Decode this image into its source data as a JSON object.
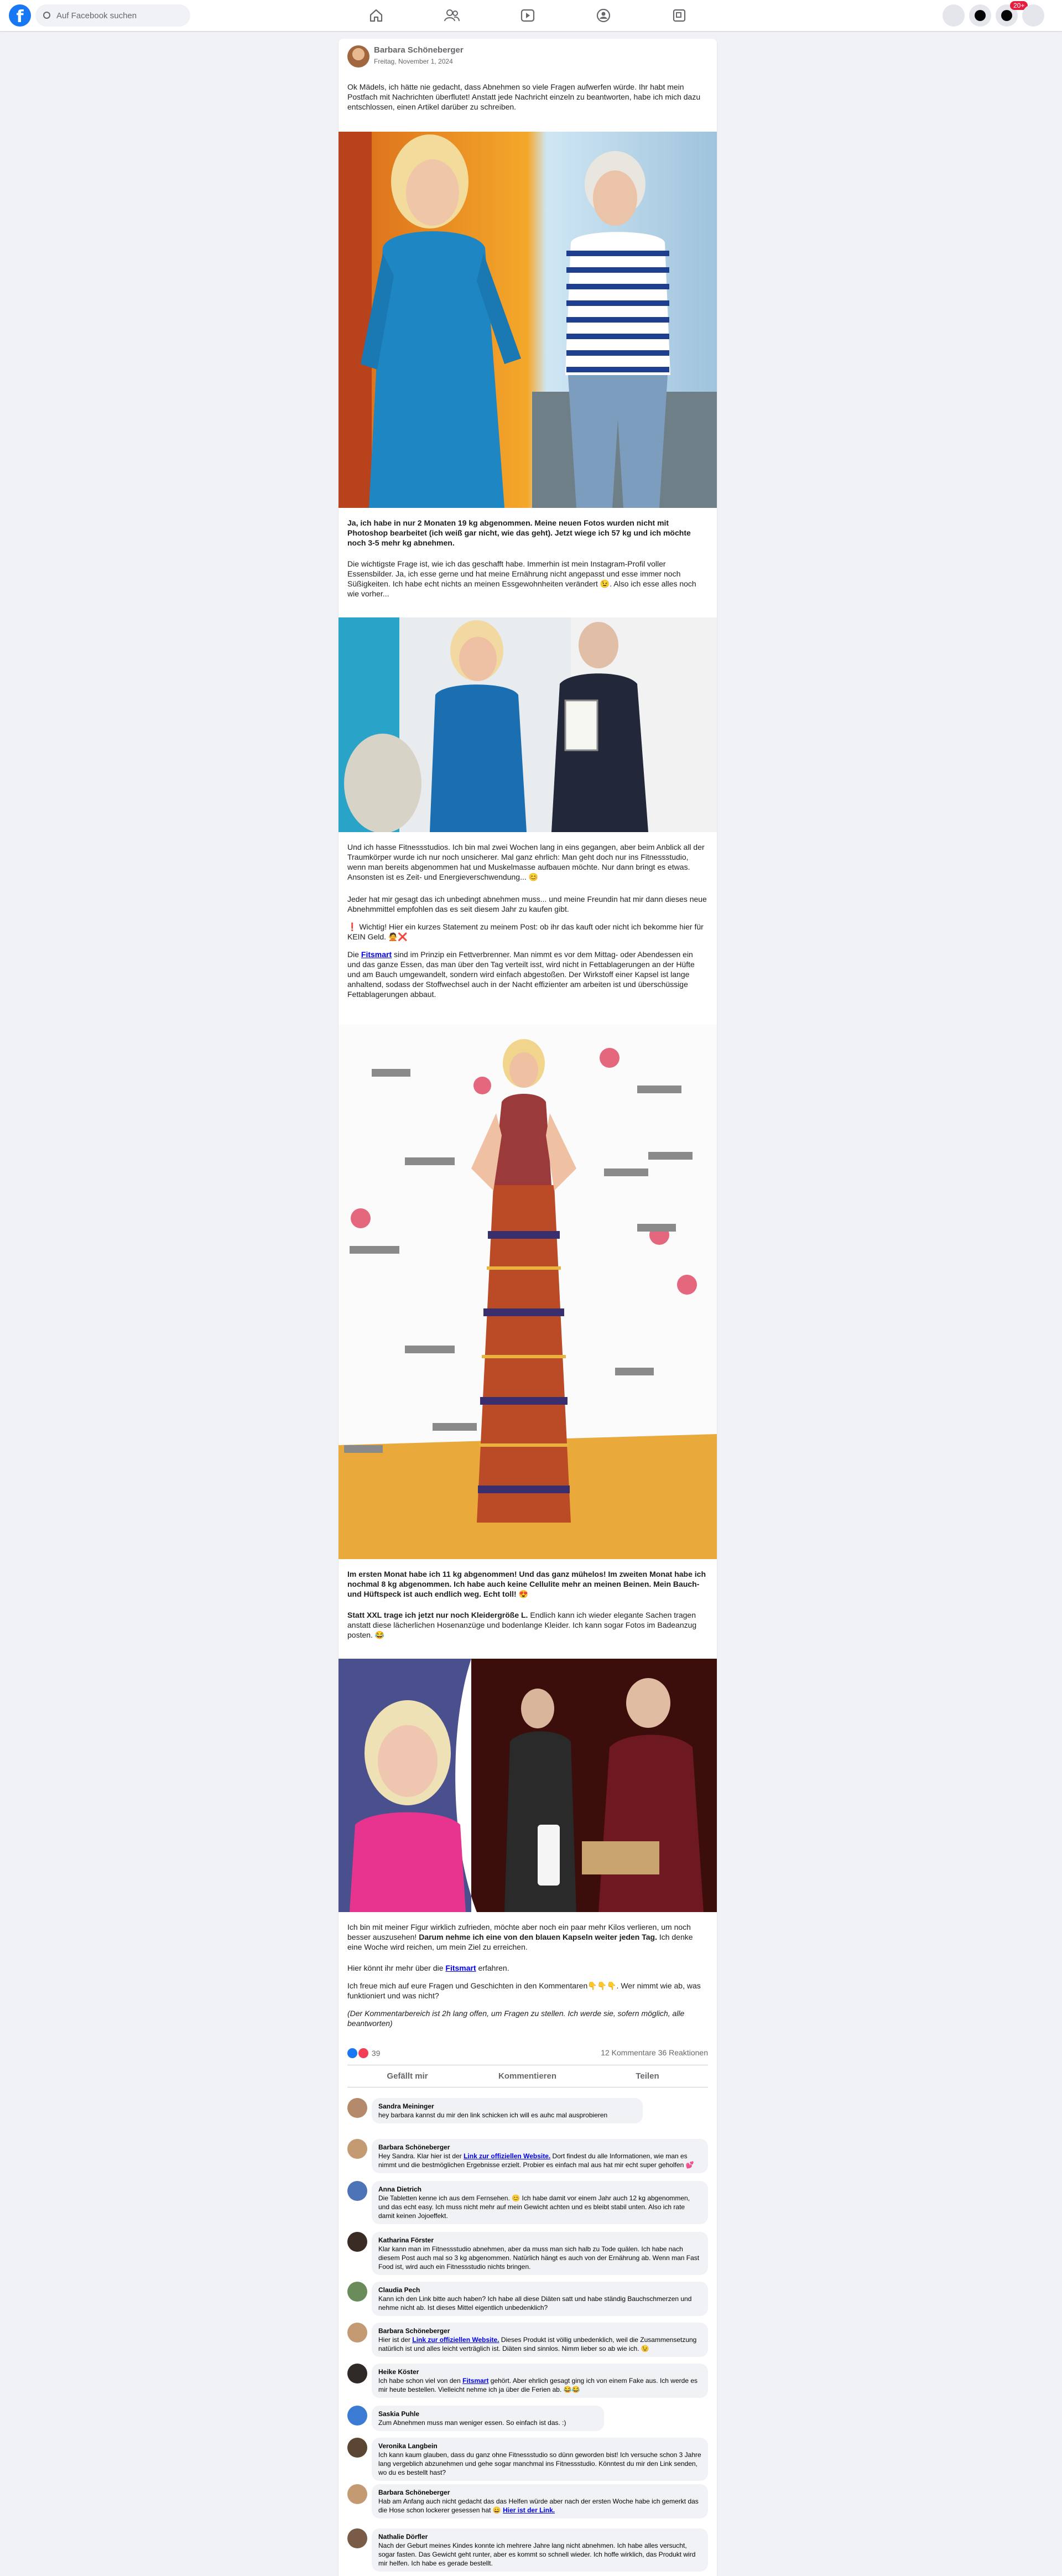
{
  "topbar": {
    "search_placeholder": "Auf Facebook suchen",
    "logo_letter": "f",
    "notification_badge": "20+",
    "nav_icons": [
      "home-icon",
      "friends-icon",
      "video-icon",
      "groups-icon",
      "gaming-icon"
    ]
  },
  "post": {
    "author": "Barbara Schöneberger",
    "date": "Freitag, November 1, 2024",
    "p1": "Ok Mädels, ich hätte nie gedacht, dass Abnehmen so viele Fragen aufwerfen würde. Ihr habt mein Postfach mit Nachrichten überflutet! Anstatt jede Nachricht einzeln zu beantworten, habe ich mich dazu entschlossen, einen Artikel darüber zu schreiben.",
    "p2": "Ja, ich habe in nur 2 Monaten 19 kg abgenommen. Meine neuen Fotos wurden nicht mit Photoshop bearbeitet (ich weiß gar nicht, wie das geht). Jetzt wiege ich 57 kg und ich möchte noch 3-5 mehr kg abnehmen.",
    "p3": "Die wichtigste Frage ist, wie ich das geschafft habe. Immerhin ist mein Instagram-Profil voller Essensbilder. Ja, ich esse gerne und hat meine Ernährung nicht angepasst und esse immer noch Süßigkeiten. Ich habe echt nichts an meinen Essgewohnheiten verändert 😉. Also ich esse alles noch wie vorher...",
    "p4": "Und ich hasse Fitnessstudios. Ich bin mal zwei Wochen lang in eins gegangen, aber beim Anblick all der Traumkörper wurde ich nur noch unsicherer. Mal ganz ehrlich: Man geht doch nur ins Fitnessstudio, wenn man bereits abgenommen hat und Muskelmasse aufbauen möchte. Nur dann bringt es etwas. Ansonsten ist es Zeit- und Energieverschwendung... 😊",
    "p5": "Jeder hat mir gesagt das ich unbedingt abnehmen muss... und meine Freundin hat mir dann dieses neue Abnehmmittel empfohlen das es seit diesem Jahr zu kaufen gibt.",
    "p6": "❗ Wichtig! Hier ein kurzes Statement zu meinem Post: ob ihr das kauft oder nicht ich bekomme hier für KEIN Geld. 🙅❌",
    "p7_pre": "Die ",
    "p7_link": "Fitsmart",
    "p7_post": " sind im Prinzip ein Fettverbrenner. Man nimmt es vor dem Mittag- oder Abendessen ein und das ganze Essen, das man über den Tag verteilt isst, wird nicht in Fettablagerungen an der Hüfte und am Bauch umgewandelt, sondern wird einfach abgestoßen. Der Wirkstoff einer Kapsel ist lange anhaltend, sodass der Stoffwechsel auch in der Nacht effizienter am arbeiten ist und überschüssige Fettablagerungen abbaut.",
    "p8": "Im ersten Monat habe ich 11 kg abgenommen! Und das ganz mühelos! Im zweiten Monat habe ich nochmal 8 kg abgenommen. Ich habe auch keine Cellulite mehr an meinen Beinen. Mein Bauch- und Hüftspeck ist auch endlich weg. Echt toll! 😍",
    "p9_bold": "Statt XXL trage ich jetzt nur noch Kleidergröße L.",
    "p9_rest": " Endlich kann ich wieder elegante Sachen tragen anstatt diese lächerlichen Hosenanzüge und bodenlange Kleider. Ich kann sogar Fotos im Badeanzug posten. 😂",
    "p10_pre": "Ich bin mit meiner Figur wirklich zufrieden, möchte aber noch ein paar mehr Kilos verlieren, um noch besser auszusehen! ",
    "p10_bold": "Darum nehme ich eine von den blauen Kapseln weiter jeden Tag.",
    "p10_post": " Ich denke eine Woche wird reichen, um mein Ziel zu erreichen.",
    "p11_pre": "Hier könnt ihr mehr über die ",
    "p11_link": "Fitsmart",
    "p11_post": " erfahren.",
    "p12": "Ich freue mich auf eure Fragen und Geschichten in den Kommentaren👇👇👇. Wer nimmt wie ab, was funktioniert und was nicht?",
    "p13": "(Der Kommentarbereich ist 2h lang offen, um Fragen zu stellen. Ich werde sie, sofern möglich, alle beantworten)",
    "image_alts": [
      "Vorher-Nachher Foto im blauen Kleid und gestreiften Shirt",
      "Foto mit Auszeichnung bei einer Veranstaltung",
      "Foto im gemusterten Kleid auf dem roten Teppich",
      "TV-Studio Foto mit Produkt"
    ]
  },
  "reactions": {
    "count": "39",
    "comments_shares": "12 Kommentare  36 Reaktionen",
    "like_label": "Gefällt mir",
    "comment_label": "Kommentieren",
    "share_label": "Teilen"
  },
  "comments": [
    {
      "name": "Sandra Meininger",
      "text": "hey barbara kannst du mir den link schicken ich will es auhc mal ausprobieren",
      "avatar": "#b48a6a"
    },
    {
      "name": "Barbara Schöneberger",
      "text_pre": "Hey Sandra. Klar hier ist der ",
      "link": "Link zur offiziellen Website.",
      "text_post": " Dort findest du alle Informationen, wie man es nimmt und die bestmöglichen Ergebnisse erzielt. Probier es einfach mal aus hat mir echt super geholfen 💕",
      "avatar": "#c49a72"
    },
    {
      "name": "Anna Dietrich",
      "text": "Die Tabletten kenne ich aus dem Fernsehen. 😊 Ich habe damit vor einem Jahr auch 12 kg abgenommen, und das echt easy. Ich muss nicht mehr auf mein Gewicht achten und es bleibt stabil unten. Also ich rate damit keinen Jojoeffekt.",
      "avatar": "#4d74b6"
    },
    {
      "name": "Katharina Förster",
      "text": "Klar kann man im Fitnessstudio abnehmen, aber da muss man sich halb zu Tode quälen. Ich habe nach diesem Post auch mal so 3 kg abgenommen. Natürlich hängt es auch von der Ernährung ab. Wenn man Fast Food ist, wird auch ein Fitnessstudio nichts bringen.",
      "avatar": "#3a2b25"
    },
    {
      "name": "Claudia Pech",
      "text": "Kann ich den Link bitte auch haben? Ich habe all diese Diäten satt und habe ständig Bauchschmerzen und nehme nicht ab. Ist dieses Mittel eigentlich unbedenklich?",
      "avatar": "#6a8c5a"
    },
    {
      "name": "Barbara Schöneberger",
      "text_pre": "Hier ist der ",
      "link": "Link zur offiziellen Website.",
      "text_post": " Dieses Produkt ist völlig unbedenklich, weil die Zusammensetzung natürlich ist und alles leicht verträglich ist. Diäten sind sinnlos. Nimm lieber so ab wie ich. 😉",
      "avatar": "#c49a72"
    },
    {
      "name": "Heike Köster",
      "text_pre": "Ich habe schon viel von den ",
      "link": "Fitsmart",
      "text_post": " gehört. Aber ehrlich gesagt ging ich von einem Fake aus. Ich werde es mir heute bestellen. Vielleicht nehme ich ja über die Ferien ab. 😂😂",
      "avatar": "#2f2a28"
    },
    {
      "name": "Saskia Puhle",
      "text": "Zum Abnehmen muss man weniger essen. So einfach ist das. :)",
      "avatar": "#3b7bd4"
    },
    {
      "name": "Veronika Langbein",
      "text": "Ich kann kaum glauben, dass du ganz ohne Fitnessstudio so dünn geworden bist! Ich versuche schon 3 Jahre lang vergeblich abzunehmen und gehe sogar manchmal ins Fitnessstudio. Könntest du mir den Link senden, wo du es bestellt hast?",
      "avatar": "#5a4632"
    },
    {
      "name": "Barbara Schöneberger",
      "text_pre": "Hab am Anfang auch nicht gedacht das das Helfen würde aber nach der ersten Woche habe ich gemerkt das die Hose schon lockerer gesessen hat 😄 ",
      "link": "Hier ist der Link.",
      "text_post": "",
      "avatar": "#c49a72"
    },
    {
      "name": "Nathalie Dörfler",
      "text": "Nach der Geburt meines Kindes konnte ich mehrere Jahre lang nicht abnehmen. Ich habe alles versucht, sogar fasten. Das Gewicht geht runter, aber es kommt so schnell wieder. Ich hoffe wirklich, das Produkt wird mir helfen. Ich habe es gerade bestellt.",
      "avatar": "#7a5b48"
    }
  ]
}
